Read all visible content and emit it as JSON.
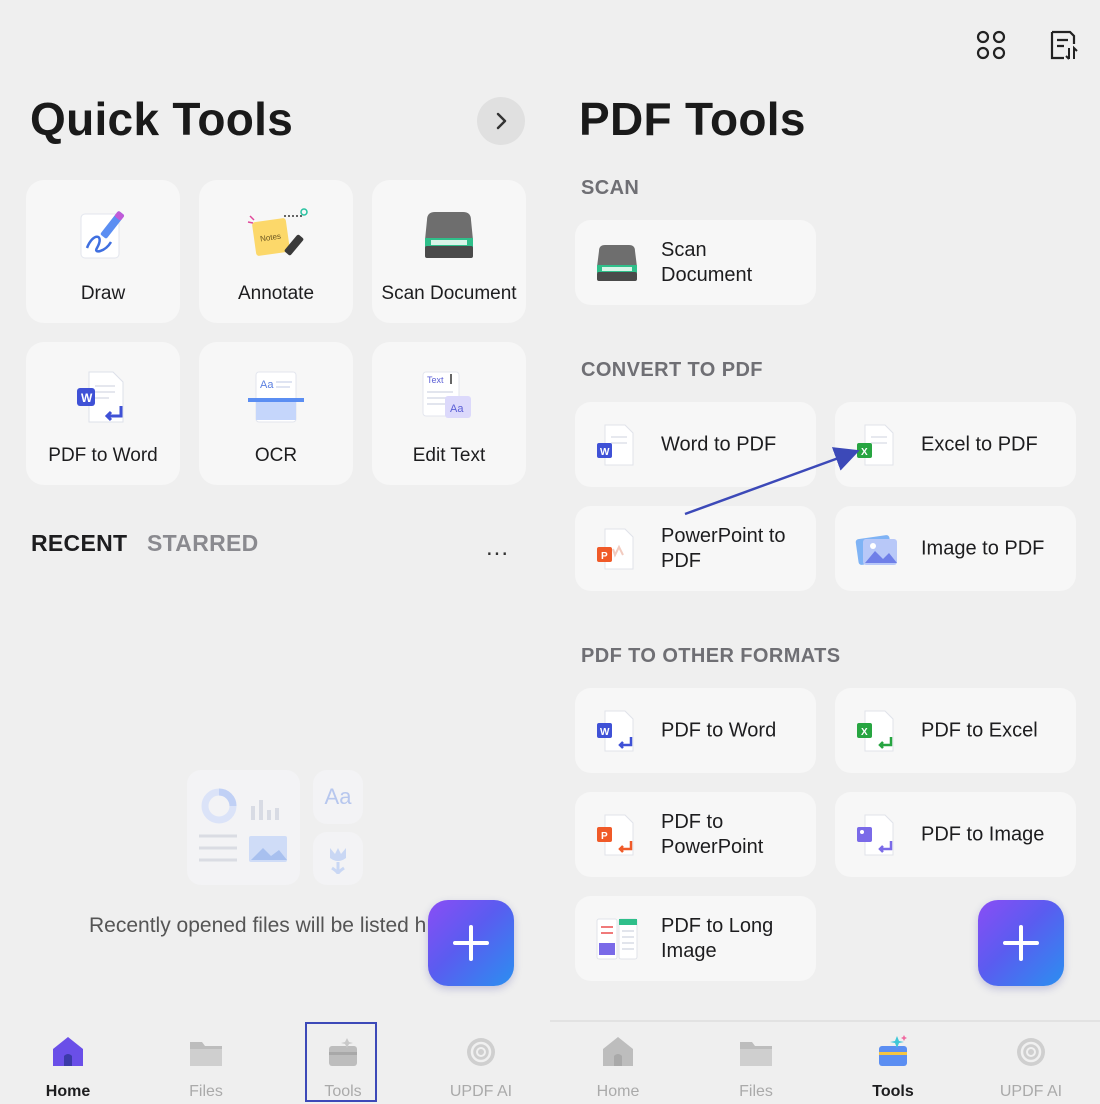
{
  "left": {
    "title": "Quick Tools",
    "quick_tools": [
      {
        "label": "Draw",
        "icon": "draw-icon"
      },
      {
        "label": "Annotate",
        "icon": "annotate-icon"
      },
      {
        "label": "Scan Document",
        "icon": "scanner-icon"
      },
      {
        "label": "PDF to Word",
        "icon": "pdf-to-word-icon"
      },
      {
        "label": "OCR",
        "icon": "ocr-icon"
      },
      {
        "label": "Edit Text",
        "icon": "edit-text-icon"
      }
    ],
    "tabs": {
      "recent": "RECENT",
      "starred": "STARRED"
    },
    "more_label": "...",
    "empty_message": "Recently opened files will be listed h",
    "empty_glyph": "Aa",
    "annotate_sticker": "Notes",
    "edit_text_sticker": "Text",
    "ocr_sticker": "Aa",
    "nav": [
      {
        "label": "Home",
        "active": true
      },
      {
        "label": "Files",
        "active": false
      },
      {
        "label": "Tools",
        "active": false
      },
      {
        "label": "UPDF AI",
        "active": false
      }
    ]
  },
  "right": {
    "title": "PDF Tools",
    "sections": {
      "scan": "SCAN",
      "convert": "CONVERT TO PDF",
      "other": "PDF TO OTHER FORMATS"
    },
    "scan_tools": [
      {
        "label": "Scan Document",
        "icon": "scanner-icon"
      }
    ],
    "convert_tools": [
      {
        "label": "Word to PDF",
        "icon": "word-doc-icon"
      },
      {
        "label": "Excel to PDF",
        "icon": "excel-doc-icon"
      },
      {
        "label": "PowerPoint to PDF",
        "icon": "powerpoint-doc-icon"
      },
      {
        "label": "Image to PDF",
        "icon": "image-doc-icon"
      }
    ],
    "other_tools": [
      {
        "label": "PDF to Word",
        "icon": "pdf-to-word-icon"
      },
      {
        "label": "PDF to Excel",
        "icon": "pdf-to-excel-icon"
      },
      {
        "label": "PDF to PowerPoint",
        "icon": "pdf-to-powerpoint-icon"
      },
      {
        "label": "PDF to Image",
        "icon": "pdf-to-image-icon"
      },
      {
        "label": "PDF to Long Image",
        "icon": "pdf-to-long-image-icon"
      }
    ],
    "nav": [
      {
        "label": "Home",
        "active": false
      },
      {
        "label": "Files",
        "active": false
      },
      {
        "label": "Tools",
        "active": true
      },
      {
        "label": "UPDF AI",
        "active": false
      }
    ]
  },
  "colors": {
    "accent": "#5a5cf0",
    "word_blue": "#3f51d6",
    "excel_green": "#27a541",
    "ppt_orange": "#f05a28",
    "annotation_arrow": "#3c49b8"
  }
}
